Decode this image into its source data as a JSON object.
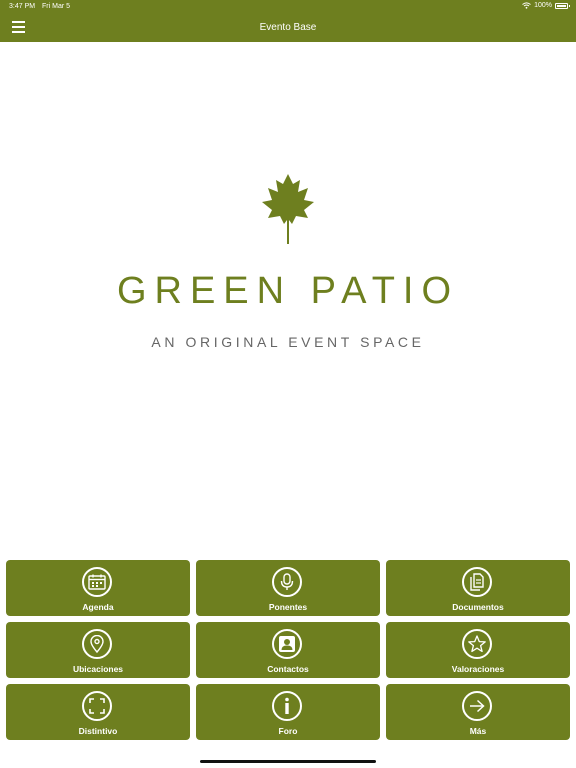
{
  "status_bar": {
    "time": "3:47 PM",
    "date": "Fri Mar 5",
    "battery": "100%"
  },
  "navbar": {
    "title": "Evento Base",
    "menu_icon": "hamburger-icon"
  },
  "hero": {
    "logo_icon": "leaf-icon",
    "brand": "GREEN PATIO",
    "tagline": "AN ORIGINAL EVENT SPACE"
  },
  "colors": {
    "accent": "#6e7f1f",
    "tagline": "#666666"
  },
  "tiles": [
    {
      "label": "Agenda",
      "icon": "calendar-icon"
    },
    {
      "label": "Ponentes",
      "icon": "microphone-icon"
    },
    {
      "label": "Documentos",
      "icon": "documents-icon"
    },
    {
      "label": "Ubicaciones",
      "icon": "location-pin-icon"
    },
    {
      "label": "Contactos",
      "icon": "contact-person-icon"
    },
    {
      "label": "Valoraciones",
      "icon": "star-icon"
    },
    {
      "label": "Distintivo",
      "icon": "badge-scan-icon"
    },
    {
      "label": "Foro",
      "icon": "info-icon"
    },
    {
      "label": "Más",
      "icon": "arrow-right-icon"
    }
  ]
}
